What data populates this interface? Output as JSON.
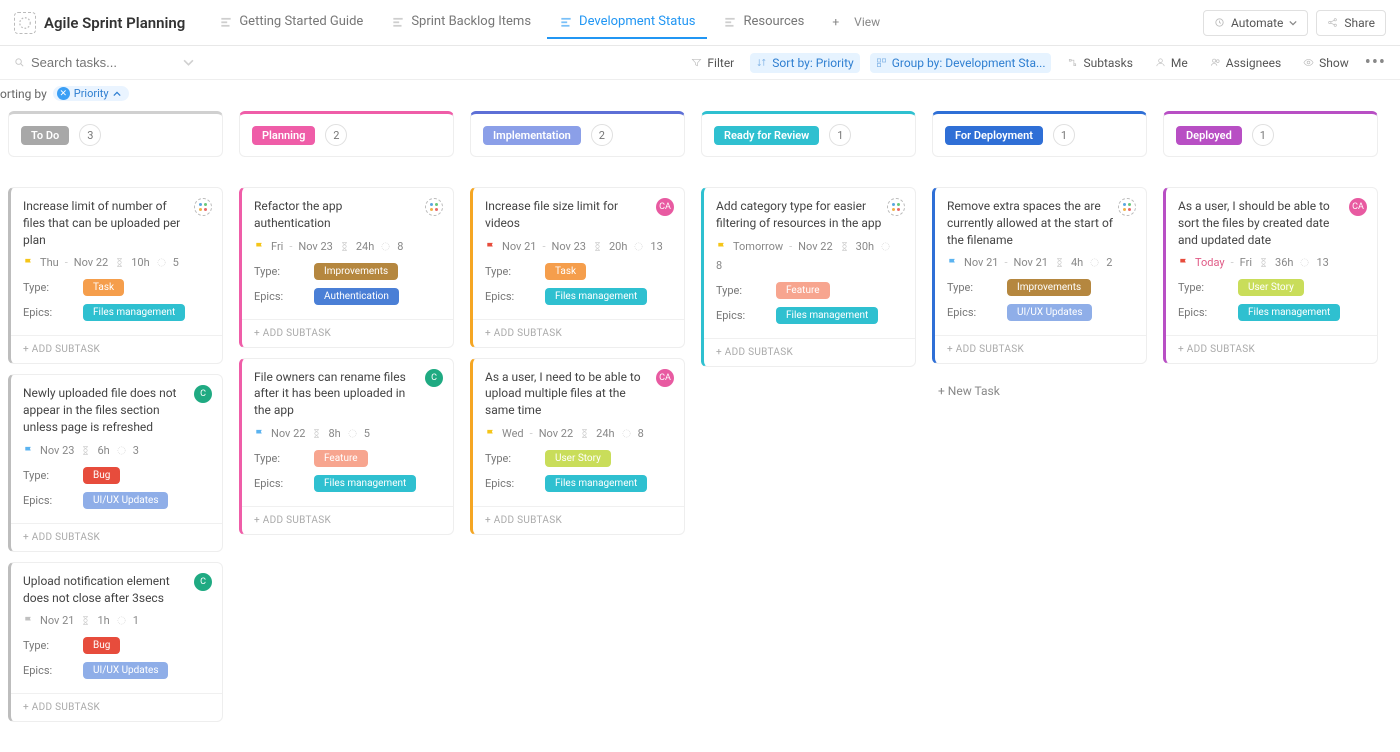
{
  "header": {
    "title": "Agile Sprint Planning",
    "tabs": [
      {
        "label": "Getting Started Guide",
        "active": false
      },
      {
        "label": "Sprint Backlog Items",
        "active": false
      },
      {
        "label": "Development Status",
        "active": true
      },
      {
        "label": "Resources",
        "active": false
      }
    ],
    "addView": "View",
    "automate": "Automate",
    "share": "Share"
  },
  "toolbar": {
    "searchPlaceholder": "Search tasks...",
    "filter": "Filter",
    "sortBy": "Sort by: Priority",
    "groupBy": "Group by: Development Sta...",
    "subtasks": "Subtasks",
    "me": "Me",
    "assignees": "Assignees",
    "show": "Show"
  },
  "sorting": {
    "label": "orting by",
    "pill": "Priority"
  },
  "addSubtask": "+ ADD SUBTASK",
  "newTask": "+ New Task",
  "fieldLabels": {
    "type": "Type:",
    "epics": "Epics:"
  },
  "columns": [
    {
      "name": "To Do",
      "count": "3",
      "statusBg": "#a8a8a8",
      "border": "#d0d0d0",
      "leftBorder": "#bdbdbd",
      "cards": [
        {
          "title": "Increase limit of number of files that can be uploaded per plan",
          "avatar": "sprint",
          "flag": "yellow",
          "date1": "Thu",
          "date2": "Nov 22",
          "hours": "10h",
          "pts": "5",
          "type": {
            "text": "Task",
            "cls": "tag-task"
          },
          "epics": {
            "text": "Files management",
            "cls": "tag-files"
          }
        },
        {
          "title": "Newly uploaded file does not appear in the files section unless page is refreshed",
          "avatar": "teal",
          "flag": "blue",
          "date1": "Nov 23",
          "date2": "",
          "hours": "6h",
          "pts": "3",
          "type": {
            "text": "Bug",
            "cls": "tag-bug"
          },
          "epics": {
            "text": "UI/UX Updates",
            "cls": "tag-uiux"
          }
        },
        {
          "title": "Upload notification element does not close after 3secs",
          "avatar": "teal",
          "flag": "grey",
          "date1": "Nov 21",
          "date2": "",
          "hours": "1h",
          "pts": "1",
          "type": {
            "text": "Bug",
            "cls": "tag-bug"
          },
          "epics": {
            "text": "UI/UX Updates",
            "cls": "tag-uiux"
          }
        }
      ]
    },
    {
      "name": "Planning",
      "count": "2",
      "statusBg": "#ef5da8",
      "border": "#ef5da8",
      "leftBorder": "#ef5da8",
      "cards": [
        {
          "title": "Refactor the app authentication",
          "avatar": "sprint",
          "flag": "yellow",
          "date1": "Fri",
          "date2": "Nov 23",
          "hours": "24h",
          "pts": "8",
          "type": {
            "text": "Improvements",
            "cls": "tag-improve"
          },
          "epics": {
            "text": "Authentication",
            "cls": "tag-auth"
          }
        },
        {
          "title": "File owners can rename files after it has been uploaded in the app",
          "avatar": "teal",
          "flag": "blue",
          "date1": "Nov 22",
          "date2": "",
          "hours": "8h",
          "pts": "5",
          "type": {
            "text": "Feature",
            "cls": "tag-feature"
          },
          "epics": {
            "text": "Files management",
            "cls": "tag-files"
          }
        }
      ]
    },
    {
      "name": "Implementation",
      "count": "2",
      "statusBg": "#8b9fe8",
      "border": "#5d6fd6",
      "leftBorder": "#f5a623",
      "cards": [
        {
          "title": "Increase file size limit for videos",
          "avatar": "pink",
          "flag": "red",
          "date1": "Nov 21",
          "date2": "Nov 23",
          "hours": "20h",
          "pts": "13",
          "type": {
            "text": "Task",
            "cls": "tag-task"
          },
          "epics": {
            "text": "Files management",
            "cls": "tag-files"
          }
        },
        {
          "title": "As a user, I need to be able to upload multiple files at the same time",
          "avatar": "pink",
          "flag": "yellow",
          "date1": "Wed",
          "date2": "Nov 22",
          "hours": "24h",
          "pts": "8",
          "type": {
            "text": "User Story",
            "cls": "tag-story"
          },
          "epics": {
            "text": "Files management",
            "cls": "tag-files"
          }
        }
      ]
    },
    {
      "name": "Ready for Review",
      "count": "1",
      "statusBg": "#2fc0d0",
      "border": "#2fc0d0",
      "leftBorder": "#2fc0d0",
      "cards": [
        {
          "title": "Add category type for easier filtering of resources in the app",
          "avatar": "sprint",
          "flag": "yellow",
          "date1": "Tomorrow",
          "date2": "Nov 22",
          "hours": "30h",
          "pts": "8",
          "type": {
            "text": "Feature",
            "cls": "tag-feature"
          },
          "epics": {
            "text": "Files management",
            "cls": "tag-files"
          }
        }
      ]
    },
    {
      "name": "For Deployment",
      "count": "1",
      "statusBg": "#2f6fd6",
      "border": "#2f6fd6",
      "leftBorder": "#2f6fd6",
      "showNewTask": true,
      "cards": [
        {
          "title": "Remove extra spaces the are currently allowed at the start of the filename",
          "avatar": "sprint",
          "flag": "blue",
          "date1": "Nov 21",
          "date2": "Nov 21",
          "hours": "4h",
          "pts": "2",
          "type": {
            "text": "Improvements",
            "cls": "tag-improve"
          },
          "epics": {
            "text": "UI/UX Updates",
            "cls": "tag-uiux"
          }
        }
      ]
    },
    {
      "name": "Deployed",
      "count": "1",
      "statusBg": "#b84fc4",
      "border": "#b84fc4",
      "leftBorder": "#b84fc4",
      "cards": [
        {
          "title": "As a user, I should be able to sort the files by created date and updated date",
          "avatar": "pink",
          "flag": "red",
          "date1": "Today",
          "dateColor": "#e05a86",
          "date2": "Fri",
          "hours": "36h",
          "pts": "13",
          "type": {
            "text": "User Story",
            "cls": "tag-story"
          },
          "epics": {
            "text": "Files management",
            "cls": "tag-files"
          }
        }
      ]
    }
  ]
}
